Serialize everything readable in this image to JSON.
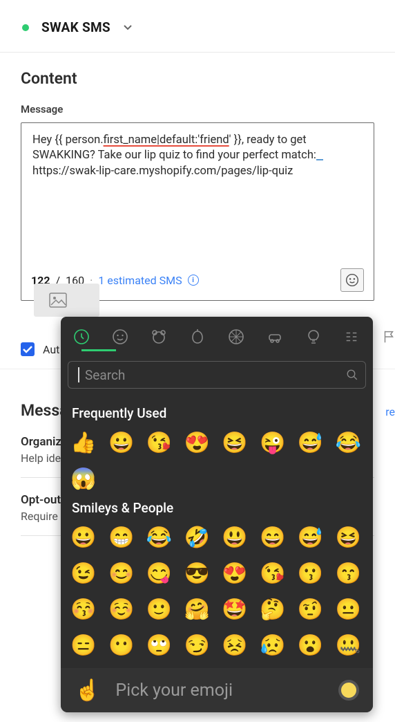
{
  "header": {
    "title": "SWAK SMS"
  },
  "content": {
    "section_title": "Content",
    "message_label": "Message",
    "message_text_prefix": "Hey {{ person.",
    "message_underlined": "first_name|default:'friend",
    "message_text_suffix": "' }}, ready to get SWAKKING? Take our lip quiz to find your perfect match:",
    "message_url": "https://swak-lip-care.myshopify.com/pages/lip-quiz",
    "char_count": "122",
    "char_max": "160",
    "estimate_text": "1 estimated SMS",
    "auto_label": "Aut"
  },
  "picker": {
    "search_placeholder": "Search",
    "freq_title": "Frequently Used",
    "freq_emojis": [
      "👍",
      "😀",
      "😘",
      "😍",
      "😆",
      "😜",
      "😅",
      "😂",
      "😱"
    ],
    "smileys_title": "Smileys & People",
    "smileys_emojis": [
      "😀",
      "😁",
      "😂",
      "🤣",
      "😃",
      "😄",
      "😅",
      "😆",
      "😉",
      "😊",
      "😋",
      "😎",
      "😍",
      "😘",
      "😗",
      "😙",
      "😚",
      "☺️",
      "🙂",
      "🤗",
      "🤩",
      "🤔",
      "🤨",
      "😐",
      "😑",
      "😶",
      "🙄",
      "😏",
      "😣",
      "😥",
      "😮",
      "🤐"
    ],
    "footer_emoji": "☝️",
    "footer_text": "Pick your emoji"
  },
  "below": {
    "title_partial": "Messa",
    "more": "re",
    "org_label": "Organiz",
    "org_desc": "Help ide",
    "optout_label": "Opt-out",
    "optout_desc": "Require"
  }
}
